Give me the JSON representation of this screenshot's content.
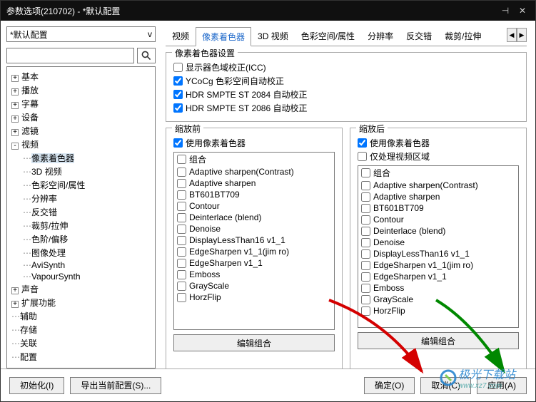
{
  "window": {
    "title": "参数选项(210702) - *默认配置"
  },
  "profile": {
    "selected": "*默认配置",
    "v_label": "v",
    "search_placeholder": ""
  },
  "tree": {
    "items": [
      {
        "exp": "+",
        "label": "基本"
      },
      {
        "exp": "+",
        "label": "播放"
      },
      {
        "exp": "+",
        "label": "字幕"
      },
      {
        "exp": "+",
        "label": "设备"
      },
      {
        "exp": "+",
        "label": "滤镜"
      },
      {
        "exp": "-",
        "label": "视频",
        "children": [
          {
            "label": "像素着色器",
            "sel": true
          },
          {
            "label": "3D 视频"
          },
          {
            "label": "色彩空间/属性"
          },
          {
            "label": "分辨率"
          },
          {
            "label": "反交错"
          },
          {
            "label": "裁剪/拉伸"
          },
          {
            "label": "色阶/偏移"
          },
          {
            "label": "图像处理"
          },
          {
            "label": "AviSynth"
          },
          {
            "label": "VapourSynth"
          }
        ]
      },
      {
        "exp": "+",
        "label": "声音"
      },
      {
        "exp": "+",
        "label": "扩展功能"
      },
      {
        "exp": "",
        "label": "辅助"
      },
      {
        "exp": "",
        "label": "存储"
      },
      {
        "exp": "",
        "label": "关联"
      },
      {
        "exp": "",
        "label": "配置"
      }
    ]
  },
  "tabs": {
    "items": [
      "视频",
      "像素着色器",
      "3D 视频",
      "色彩空间/属性",
      "分辨率",
      "反交错",
      "裁剪/拉伸"
    ],
    "active": 1
  },
  "group_settings": {
    "title": "像素着色器设置",
    "opts": [
      {
        "checked": false,
        "label": "显示器色域校正(ICC)"
      },
      {
        "checked": true,
        "label": "YCoCg 色彩空间自动校正"
      },
      {
        "checked": true,
        "label": "HDR SMPTE ST 2084 自动校正"
      },
      {
        "checked": true,
        "label": "HDR SMPTE ST 2086 自动校正"
      }
    ]
  },
  "group_before": {
    "title": "缩放前",
    "use_label": "使用像素着色器",
    "use_checked": true,
    "edit_label": "编辑组合",
    "items": [
      "组合",
      "Adaptive sharpen(Contrast)",
      "Adaptive sharpen",
      "BT601BT709",
      "Contour",
      "Deinterlace (blend)",
      "Denoise",
      "DisplayLessThan16 v1_1",
      "EdgeSharpen v1_1(jim ro)",
      "EdgeSharpen v1_1",
      "Emboss",
      "GrayScale",
      "HorzFlip"
    ]
  },
  "group_after": {
    "title": "缩放后",
    "use_label": "使用像素着色器",
    "use_checked": true,
    "only_video_label": "仅处理视频区域",
    "only_video_checked": false,
    "edit_label": "编辑组合",
    "items": [
      "组合",
      "Adaptive sharpen(Contrast)",
      "Adaptive sharpen",
      "BT601BT709",
      "Contour",
      "Deinterlace (blend)",
      "Denoise",
      "DisplayLessThan16 v1_1",
      "EdgeSharpen v1_1(jim ro)",
      "EdgeSharpen v1_1",
      "Emboss",
      "GrayScale",
      "HorzFlip"
    ]
  },
  "footer": {
    "init": "初始化(I)",
    "export": "导出当前配置(S)...",
    "ok": "确定(O)",
    "cancel": "取消(C)",
    "apply": "应用(A)"
  },
  "watermark": {
    "main": "极光下载站",
    "sub": "www.xz7.com"
  }
}
